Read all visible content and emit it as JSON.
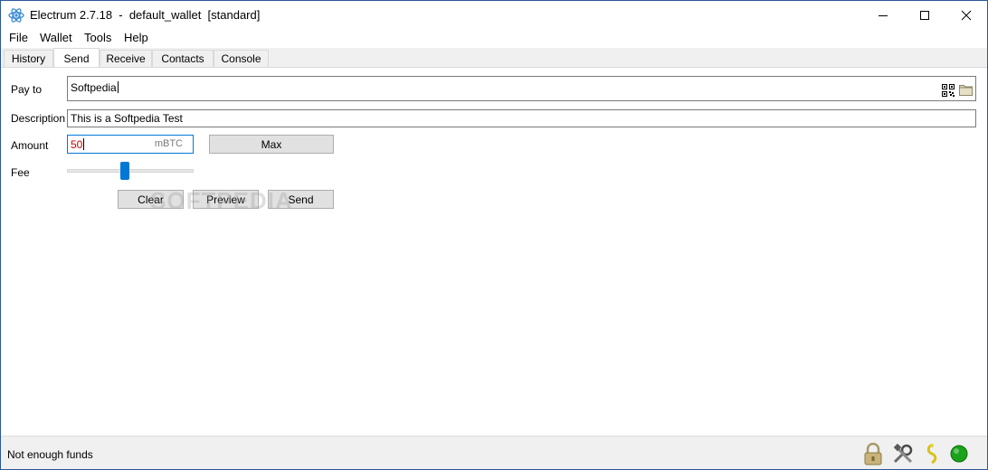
{
  "window": {
    "title": "Electrum 2.7.18  -  default_wallet  [standard]"
  },
  "menu": {
    "items": [
      "File",
      "Wallet",
      "Tools",
      "Help"
    ]
  },
  "tabs": [
    "History",
    "Send",
    "Receive",
    "Contacts",
    "Console"
  ],
  "active_tab": "Send",
  "form": {
    "pay_to_label": "Pay to",
    "pay_to_value": "Softpedia",
    "description_label": "Description",
    "description_value": "This is a Softpedia Test",
    "amount_label": "Amount",
    "amount_value": "50",
    "amount_unit": "mBTC",
    "max_label": "Max",
    "fee_label": "Fee",
    "fee_slider_level": 0.45,
    "clear_label": "Clear",
    "preview_label": "Preview",
    "send_label": "Send"
  },
  "watermark": "SOFTPEDIA",
  "status": {
    "message": "Not enough funds",
    "icons": [
      "lock-icon",
      "tools-icon",
      "seed-icon",
      "network-status-icon"
    ],
    "network_color": "#1aa31a"
  }
}
